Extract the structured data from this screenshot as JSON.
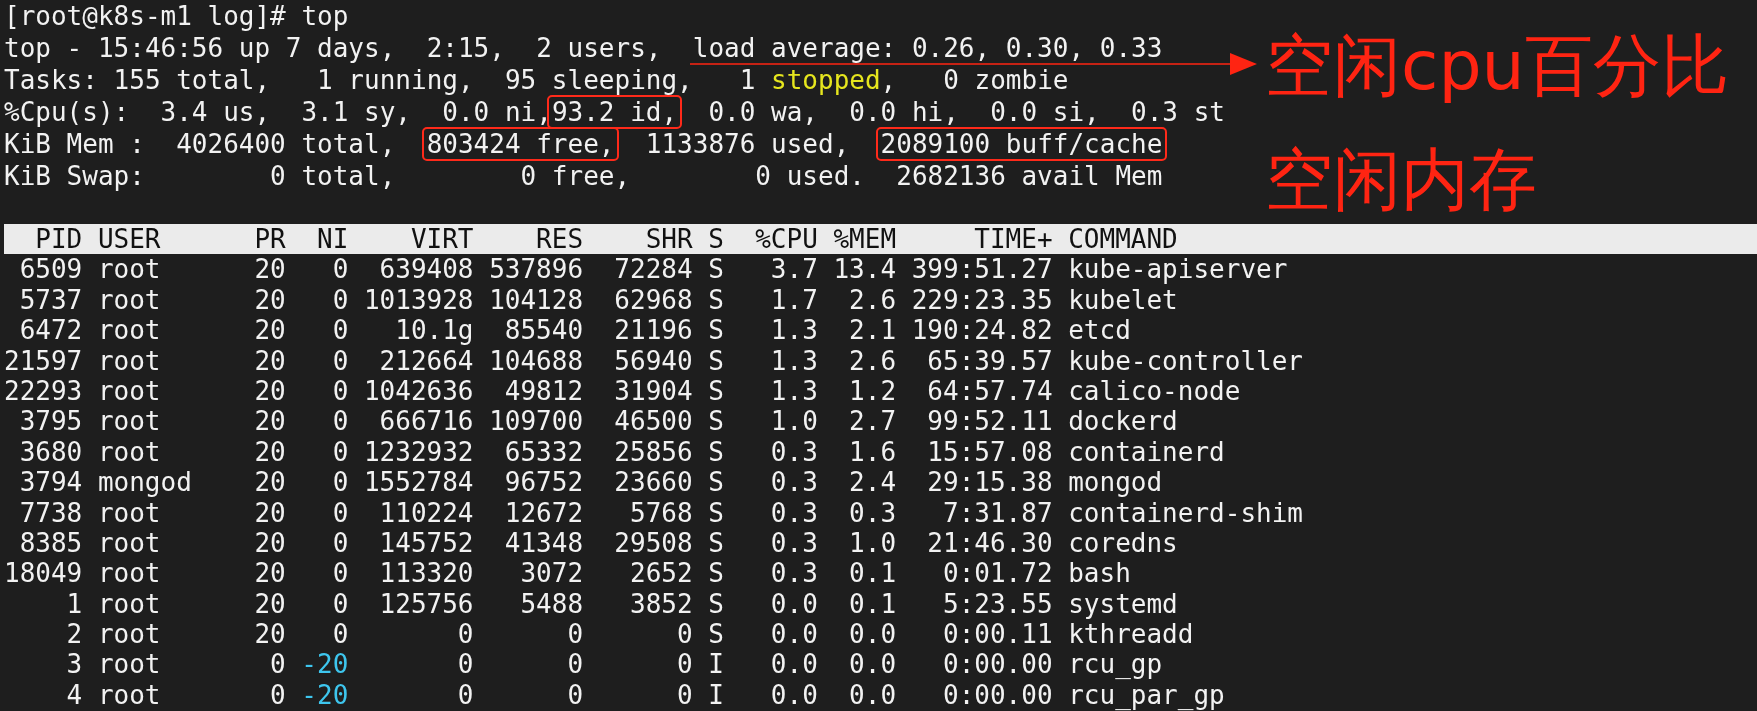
{
  "prompt": "[root@k8s-m1 log]# top",
  "summary": [
    [
      {
        "text": "top - 15:46:56 up 7 days,  2:15,  2 users,  load average: 0.26, 0.30, 0.33",
        "kind": "plain"
      }
    ],
    [
      {
        "text": "Tasks: 155 total,   1 running,  95 sleeping,   1 ",
        "kind": "plain"
      },
      {
        "text": "stopped",
        "kind": "stopped"
      },
      {
        "text": ",   0 zombie",
        "kind": "plain"
      }
    ],
    [
      {
        "text": "%Cpu(s):  3.4 us,  3.1 sy,  0.0 ni,",
        "kind": "plain"
      },
      {
        "text": "93.2 id,",
        "kind": "boxed"
      },
      {
        "text": "  0.0 wa,  0.0 hi,  0.0 si,  0.3 st",
        "kind": "plain"
      }
    ],
    [
      {
        "text": "KiB Mem :  4026400 total,  ",
        "kind": "plain"
      },
      {
        "text": "803424 free,",
        "kind": "boxed"
      },
      {
        "text": "  1133876 used,  ",
        "kind": "plain"
      },
      {
        "text": "2089100 buff/cache",
        "kind": "boxed"
      }
    ],
    [
      {
        "text": "KiB Swap:        0 total,        0 free,        0 used.  2682136 avail Mem",
        "kind": "plain"
      }
    ]
  ],
  "annotations": [
    "空闲cpu百分比",
    "空闲内存"
  ],
  "table": {
    "columns": [
      "PID",
      "USER",
      "PR",
      "NI",
      "VIRT",
      "RES",
      "SHR",
      "S",
      "%CPU",
      "%MEM",
      "TIME+",
      "COMMAND"
    ],
    "rows": [
      {
        "cells": [
          "6509",
          "root",
          "20",
          "0",
          "639408",
          "537896",
          "72284",
          "S",
          "3.7",
          "13.4",
          "399:51.27",
          "kube-apiserver"
        ],
        "ni_highlighted": false
      },
      {
        "cells": [
          "5737",
          "root",
          "20",
          "0",
          "1013928",
          "104128",
          "62968",
          "S",
          "1.7",
          "2.6",
          "229:23.35",
          "kubelet"
        ],
        "ni_highlighted": false
      },
      {
        "cells": [
          "6472",
          "root",
          "20",
          "0",
          "10.1g",
          "85540",
          "21196",
          "S",
          "1.3",
          "2.1",
          "190:24.82",
          "etcd"
        ],
        "ni_highlighted": false
      },
      {
        "cells": [
          "21597",
          "root",
          "20",
          "0",
          "212664",
          "104688",
          "56940",
          "S",
          "1.3",
          "2.6",
          "65:39.57",
          "kube-controller"
        ],
        "ni_highlighted": false
      },
      {
        "cells": [
          "22293",
          "root",
          "20",
          "0",
          "1042636",
          "49812",
          "31904",
          "S",
          "1.3",
          "1.2",
          "64:57.74",
          "calico-node"
        ],
        "ni_highlighted": false
      },
      {
        "cells": [
          "3795",
          "root",
          "20",
          "0",
          "666716",
          "109700",
          "46500",
          "S",
          "1.0",
          "2.7",
          "99:52.11",
          "dockerd"
        ],
        "ni_highlighted": false
      },
      {
        "cells": [
          "3680",
          "root",
          "20",
          "0",
          "1232932",
          "65332",
          "25856",
          "S",
          "0.3",
          "1.6",
          "15:57.08",
          "containerd"
        ],
        "ni_highlighted": false
      },
      {
        "cells": [
          "3794",
          "mongod",
          "20",
          "0",
          "1552784",
          "96752",
          "23660",
          "S",
          "0.3",
          "2.4",
          "29:15.38",
          "mongod"
        ],
        "ni_highlighted": false
      },
      {
        "cells": [
          "7738",
          "root",
          "20",
          "0",
          "110224",
          "12672",
          "5768",
          "S",
          "0.3",
          "0.3",
          "7:31.87",
          "containerd-shim"
        ],
        "ni_highlighted": false
      },
      {
        "cells": [
          "8385",
          "root",
          "20",
          "0",
          "145752",
          "41348",
          "29508",
          "S",
          "0.3",
          "1.0",
          "21:46.30",
          "coredns"
        ],
        "ni_highlighted": false
      },
      {
        "cells": [
          "18049",
          "root",
          "20",
          "0",
          "113320",
          "3072",
          "2652",
          "S",
          "0.3",
          "0.1",
          "0:01.72",
          "bash"
        ],
        "ni_highlighted": false
      },
      {
        "cells": [
          "1",
          "root",
          "20",
          "0",
          "125756",
          "5488",
          "3852",
          "S",
          "0.0",
          "0.1",
          "5:23.55",
          "systemd"
        ],
        "ni_highlighted": false
      },
      {
        "cells": [
          "2",
          "root",
          "20",
          "0",
          "0",
          "0",
          "0",
          "S",
          "0.0",
          "0.0",
          "0:00.11",
          "kthreadd"
        ],
        "ni_highlighted": false
      },
      {
        "cells": [
          "3",
          "root",
          "0",
          "-20",
          "0",
          "0",
          "0",
          "I",
          "0.0",
          "0.0",
          "0:00.00",
          "rcu_gp"
        ],
        "ni_highlighted": true
      },
      {
        "cells": [
          "4",
          "root",
          "0",
          "-20",
          "0",
          "0",
          "0",
          "I",
          "0.0",
          "0.0",
          "0:00.00",
          "rcu_par_gp"
        ],
        "ni_highlighted": true
      }
    ]
  }
}
